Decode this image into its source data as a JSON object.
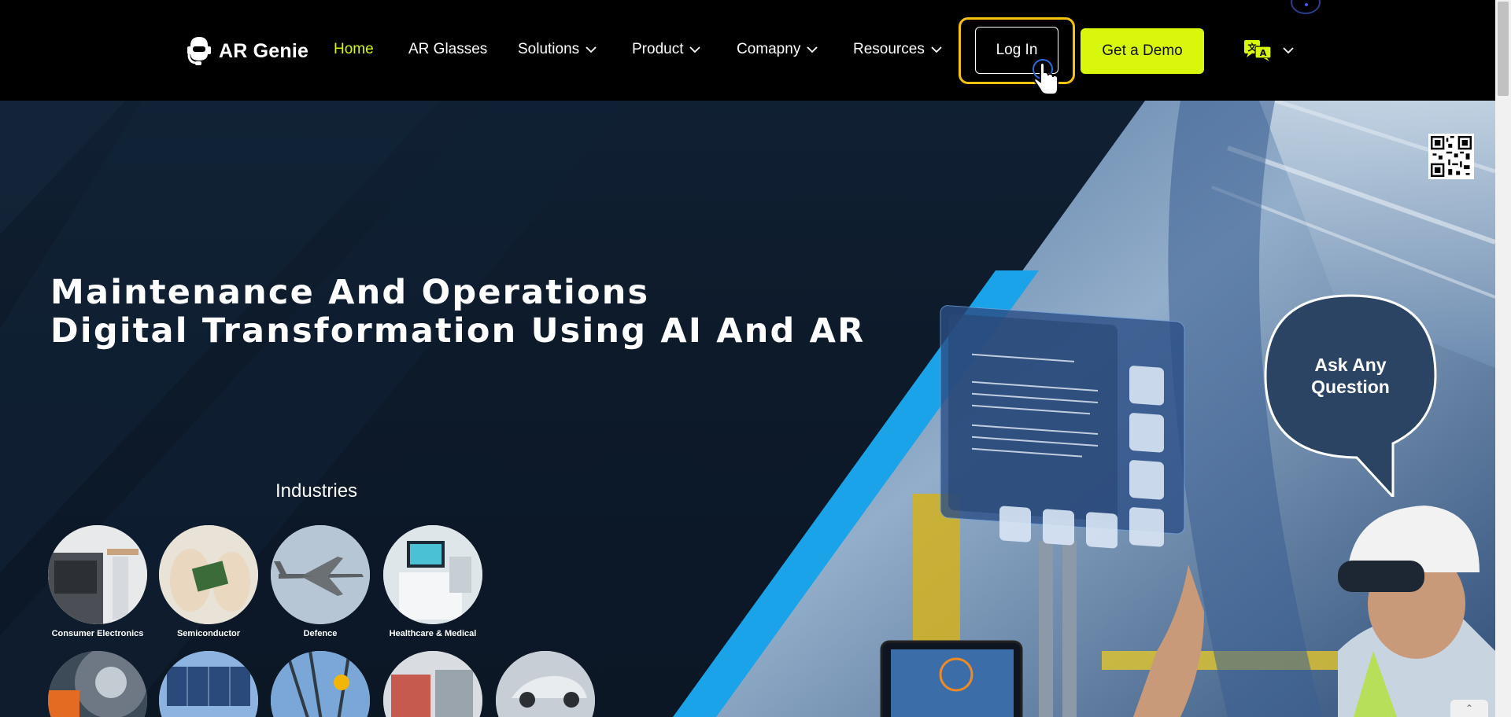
{
  "brand": {
    "name": "AR Genie"
  },
  "nav": {
    "items": [
      {
        "label": "Home",
        "active": true,
        "dropdown": false
      },
      {
        "label": "AR Glasses",
        "active": false,
        "dropdown": false
      },
      {
        "label": "Solutions",
        "active": false,
        "dropdown": true
      },
      {
        "label": "Product",
        "active": false,
        "dropdown": true
      },
      {
        "label": "Comapny",
        "active": false,
        "dropdown": true
      },
      {
        "label": "Resources",
        "active": false,
        "dropdown": true
      }
    ],
    "login_label": "Log In",
    "demo_label": "Get a Demo",
    "language_icon": "translate-icon"
  },
  "hero": {
    "headline_line1": "Maintenance And Operations",
    "headline_line2": "Digital Transformation Using AI And AR",
    "industries_title": "Industries",
    "industries_row1": [
      "Consumer Electronics",
      "Semiconductor",
      "Defence",
      "Healthcare & Medical"
    ],
    "bubble_line1": "Ask Any",
    "bubble_line2": "Question"
  },
  "colors": {
    "accent": "#d9f70a",
    "focus": "#f7c20b",
    "hero_bg": "#0d1a2a",
    "stripe": "#1aa3e8"
  }
}
